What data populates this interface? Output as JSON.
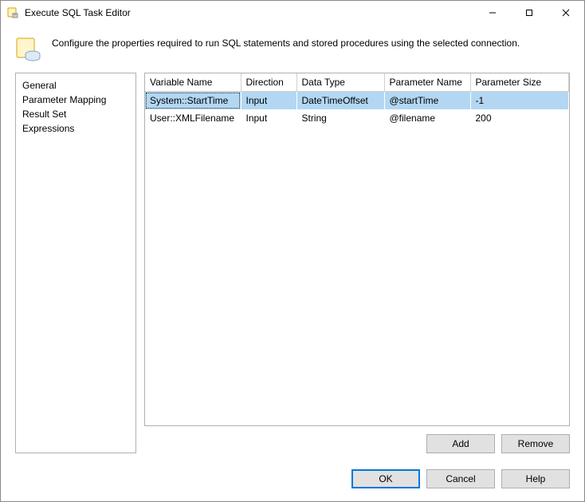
{
  "window": {
    "title": "Execute SQL Task Editor"
  },
  "header": {
    "description": "Configure the properties required to run SQL statements and stored procedures using the selected connection."
  },
  "sidebar": {
    "items": [
      {
        "label": "General",
        "selected": false
      },
      {
        "label": "Parameter Mapping",
        "selected": true
      },
      {
        "label": "Result Set",
        "selected": false
      },
      {
        "label": "Expressions",
        "selected": false
      }
    ]
  },
  "grid": {
    "columns": [
      {
        "label": "Variable Name"
      },
      {
        "label": "Direction"
      },
      {
        "label": "Data Type"
      },
      {
        "label": "Parameter Name"
      },
      {
        "label": "Parameter Size"
      }
    ],
    "rows": [
      {
        "selected": true,
        "variable": "System::StartTime",
        "direction": "Input",
        "dataType": "DateTimeOffset",
        "paramName": "@startTime",
        "paramSize": "-1"
      },
      {
        "selected": false,
        "variable": "User::XMLFilename",
        "direction": "Input",
        "dataType": "String",
        "paramName": "@filename",
        "paramSize": "200"
      }
    ]
  },
  "panelButtons": {
    "add": "Add",
    "remove": "Remove"
  },
  "dialogButtons": {
    "ok": "OK",
    "cancel": "Cancel",
    "help": "Help"
  }
}
